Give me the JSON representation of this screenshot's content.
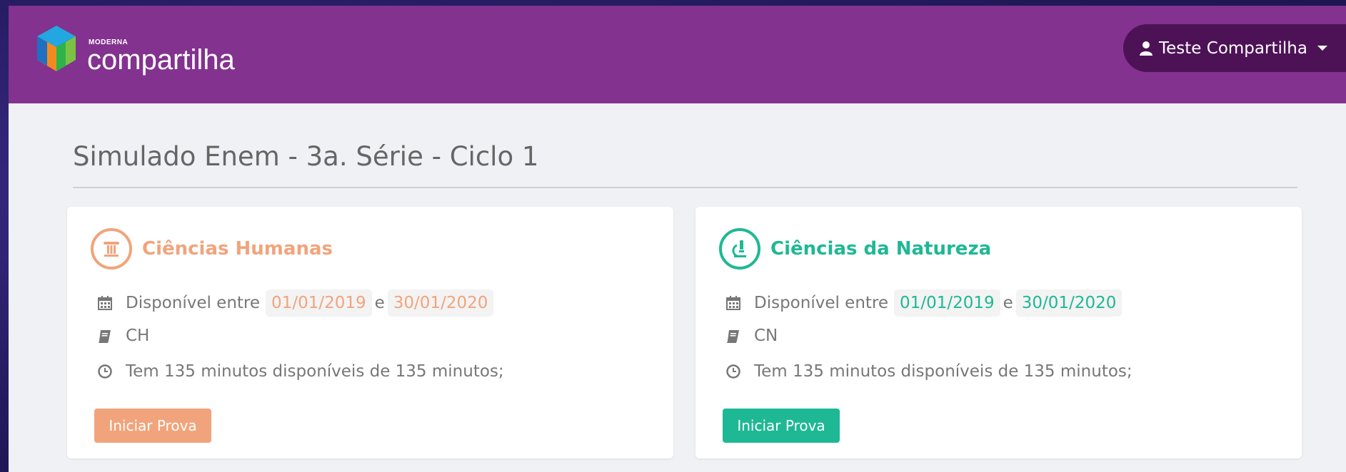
{
  "colors": {
    "header": "#83328f",
    "user_button": "#4d1256",
    "human_accent": "#f1a47c",
    "nature_accent": "#1fb894"
  },
  "header": {
    "logo_small": "MODERNA",
    "logo_big": "compartilha",
    "user_label": "Teste Compartilha"
  },
  "page": {
    "title": "Simulado Enem - 3a. Série - Ciclo 1"
  },
  "cards": [
    {
      "icon": "column-pillar-icon",
      "title": "Ciências Humanas",
      "available_label": "Disponível entre",
      "start_date": "01/01/2019",
      "connector": "e",
      "end_date": "30/01/2020",
      "code": "CH",
      "time_text": "Tem 135 minutos disponíveis de 135 minutos;",
      "button_label": "Iniciar Prova"
    },
    {
      "icon": "microscope-icon",
      "title": "Ciências da Natureza",
      "available_label": "Disponível entre",
      "start_date": "01/01/2019",
      "connector": "e",
      "end_date": "30/01/2020",
      "code": "CN",
      "time_text": "Tem 135 minutos disponíveis de 135 minutos;",
      "button_label": "Iniciar Prova"
    }
  ]
}
